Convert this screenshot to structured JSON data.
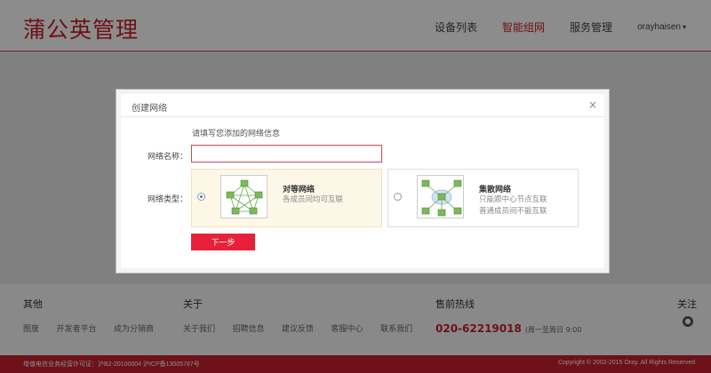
{
  "header": {
    "logo": "蒲公英管理",
    "nav": [
      "设备列表",
      "智能组网",
      "服务管理"
    ],
    "user": "orayhaisen",
    "user_caret": "▾"
  },
  "modal": {
    "title": "创建网络",
    "close": "×",
    "hint": "请填写您添加的网络信息",
    "name_label": "网络名称：",
    "name_value": "",
    "type_label": "网络类型：",
    "options": [
      {
        "title": "对等网络",
        "desc_lines": [
          "各成员间均可互联"
        ],
        "selected": true
      },
      {
        "title": "集散网络",
        "desc_lines": [
          "只能跟中心节点互联",
          "普通成员间不能互联"
        ],
        "selected": false
      }
    ],
    "next_button": "下一步"
  },
  "footer": {
    "other": {
      "title": "其他",
      "links": [
        "图度",
        "开发者平台",
        "成为分销商"
      ]
    },
    "about": {
      "title": "关于",
      "links": [
        "关于我们",
        "招聘信息",
        "建议反馈",
        "客服中心",
        "联系我们"
      ]
    },
    "sales": {
      "title": "售前热线",
      "phone": "020-62219018",
      "note": "(周一至周日 9:00"
    },
    "follow": {
      "title": "关注"
    },
    "license": "增值电信业务经营许可证：沪B2-20100004 沪ICP备13005787号",
    "copyright": "Copyright © 2002-2015 Oray. All Rights Reserved"
  },
  "colors": {
    "brand": "#c8202f",
    "button": "#e8203a",
    "selected_bg": "#fdf7e8"
  }
}
